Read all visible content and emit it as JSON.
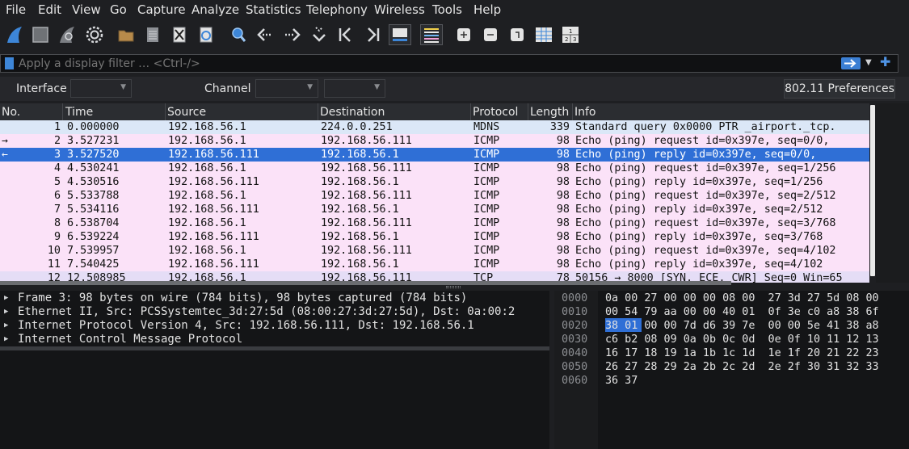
{
  "menu": [
    "File",
    "Edit",
    "View",
    "Go",
    "Capture",
    "Analyze",
    "Statistics",
    "Telephony",
    "Wireless",
    "Tools",
    "Help"
  ],
  "toolbar": {
    "icons": [
      "shark-fin-icon",
      "stop-icon",
      "restart-icon",
      "options-gear-icon",
      "open-folder-icon",
      "save-file-icon",
      "close-file-icon",
      "reload-icon",
      "find-icon",
      "go-back-icon",
      "go-forward-icon",
      "go-to-packet-icon",
      "first-packet-icon",
      "last-packet-icon",
      "autoscroll-icon",
      "colorize-icon",
      "zoom-in-icon",
      "zoom-out-icon",
      "normal-size-icon",
      "resize-columns-icon",
      "expand-subtrees-icon"
    ]
  },
  "filter": {
    "placeholder": "Apply a display filter … <Ctrl-/>"
  },
  "interface_bar": {
    "interface_label": "Interface",
    "channel_label": "Channel",
    "preferences_button": "802.11 Preferences"
  },
  "packet_list": {
    "columns": [
      "No.",
      "Time",
      "Source",
      "Destination",
      "Protocol",
      "Length",
      "Info"
    ],
    "rows": [
      {
        "no": "1",
        "time": "0.000000",
        "src": "192.168.56.1",
        "dst": "224.0.0.251",
        "proto": "MDNS",
        "len": "339",
        "info": "Standard query 0x0000 PTR _airport._tcp.",
        "mark": ""
      },
      {
        "no": "2",
        "time": "3.527231",
        "src": "192.168.56.1",
        "dst": "192.168.56.111",
        "proto": "ICMP",
        "len": "98",
        "info": "Echo (ping) request  id=0x397e, seq=0/0,",
        "mark": "→"
      },
      {
        "no": "3",
        "time": "3.527520",
        "src": "192.168.56.111",
        "dst": "192.168.56.1",
        "proto": "ICMP",
        "len": "98",
        "info": "Echo (ping) reply    id=0x397e, seq=0/0,",
        "mark": "←"
      },
      {
        "no": "4",
        "time": "4.530241",
        "src": "192.168.56.1",
        "dst": "192.168.56.111",
        "proto": "ICMP",
        "len": "98",
        "info": "Echo (ping) request  id=0x397e, seq=1/256",
        "mark": ""
      },
      {
        "no": "5",
        "time": "4.530516",
        "src": "192.168.56.111",
        "dst": "192.168.56.1",
        "proto": "ICMP",
        "len": "98",
        "info": "Echo (ping) reply    id=0x397e, seq=1/256",
        "mark": ""
      },
      {
        "no": "6",
        "time": "5.533788",
        "src": "192.168.56.1",
        "dst": "192.168.56.111",
        "proto": "ICMP",
        "len": "98",
        "info": "Echo (ping) request  id=0x397e, seq=2/512",
        "mark": ""
      },
      {
        "no": "7",
        "time": "5.534116",
        "src": "192.168.56.111",
        "dst": "192.168.56.1",
        "proto": "ICMP",
        "len": "98",
        "info": "Echo (ping) reply    id=0x397e, seq=2/512",
        "mark": ""
      },
      {
        "no": "8",
        "time": "6.538704",
        "src": "192.168.56.1",
        "dst": "192.168.56.111",
        "proto": "ICMP",
        "len": "98",
        "info": "Echo (ping) request  id=0x397e, seq=3/768",
        "mark": ""
      },
      {
        "no": "9",
        "time": "6.539224",
        "src": "192.168.56.111",
        "dst": "192.168.56.1",
        "proto": "ICMP",
        "len": "98",
        "info": "Echo (ping) reply    id=0x397e, seq=3/768",
        "mark": ""
      },
      {
        "no": "10",
        "time": "7.539957",
        "src": "192.168.56.1",
        "dst": "192.168.56.111",
        "proto": "ICMP",
        "len": "98",
        "info": "Echo (ping) request  id=0x397e, seq=4/102",
        "mark": ""
      },
      {
        "no": "11",
        "time": "7.540425",
        "src": "192.168.56.111",
        "dst": "192.168.56.1",
        "proto": "ICMP",
        "len": "98",
        "info": "Echo (ping) reply    id=0x397e, seq=4/102",
        "mark": ""
      },
      {
        "no": "12",
        "time": "12.508985",
        "src": "192.168.56.1",
        "dst": "192.168.56.111",
        "proto": "TCP",
        "len": "78",
        "info": "50156 → 8000 [SYN, ECE, CWR] Seq=0 Win=65",
        "mark": ""
      }
    ],
    "selected_row": "3"
  },
  "details": [
    "Frame 3: 98 bytes on wire (784 bits), 98 bytes captured (784 bits)",
    "Ethernet II, Src: PCSSystemtec_3d:27:5d (08:00:27:3d:27:5d), Dst: 0a:00:2",
    "Internet Protocol Version 4, Src: 192.168.56.111, Dst: 192.168.56.1",
    "Internet Control Message Protocol"
  ],
  "bytes": {
    "offsets": [
      "0000",
      "0010",
      "0020",
      "0030",
      "0040",
      "0050",
      "0060"
    ],
    "hex": [
      "0a 00 27 00 00 00 08 00  27 3d 27 5d 08 00",
      "00 54 79 aa 00 00 40 01  0f 3e c0 a8 38 6f",
      "38 01 00 00 7d d6 39 7e  00 00 5e 41 38 a8",
      "c6 b2 08 09 0a 0b 0c 0d  0e 0f 10 11 12 13",
      "16 17 18 19 1a 1b 1c 1d  1e 1f 20 21 22 23",
      "26 27 28 29 2a 2b 2c 2d  2e 2f 30 31 32 33",
      "36 37"
    ]
  },
  "colors": {
    "accent": "#2f6fd6",
    "mdns_row": "#dbe7f7",
    "icmp_row": "#fbe2f8",
    "tcp_row": "#e5ddf6"
  }
}
